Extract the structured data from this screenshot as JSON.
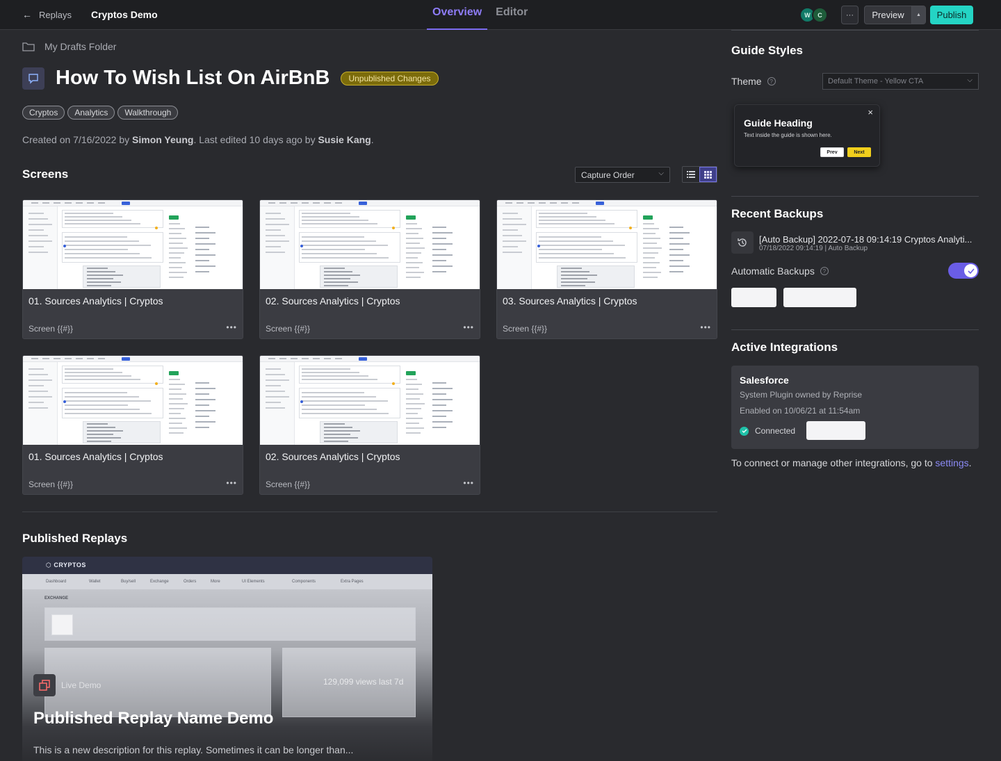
{
  "topbar": {
    "back_label": "Replays",
    "project_title": "Cryptos Demo",
    "tabs": [
      {
        "label": "Overview",
        "active": true
      },
      {
        "label": "Editor",
        "active": false
      }
    ],
    "avatars": [
      "W",
      "C"
    ],
    "more_label": "···",
    "preview_label": "Preview",
    "publish_label": "Publish"
  },
  "main": {
    "folder": "My Drafts Folder",
    "title": "How To Wish List On AirBnB",
    "status_badge": "Unpublished Changes",
    "tags": [
      "Cryptos",
      "Analytics",
      "Walkthrough"
    ],
    "created": {
      "prefix": "Created on 7/16/2022 by ",
      "creator": "Simon Yeung",
      "middle": ". Last edited 10 days ago by ",
      "editor": "Susie Kang",
      "suffix": "."
    },
    "screens_heading": "Screens",
    "sort": {
      "selected": "Capture Order"
    },
    "view_mode": "grid",
    "screens": [
      {
        "name": "01. Sources Analytics | Cryptos",
        "meta": "Screen {{#}}"
      },
      {
        "name": "02. Sources Analytics | Cryptos",
        "meta": "Screen {{#}}"
      },
      {
        "name": "03. Sources Analytics | Cryptos",
        "meta": "Screen {{#}}"
      },
      {
        "name": "01. Sources Analytics | Cryptos",
        "meta": "Screen {{#}}"
      },
      {
        "name": "02. Sources Analytics | Cryptos",
        "meta": "Screen {{#}}"
      }
    ],
    "card_more": "•••",
    "published_heading": "Published Replays",
    "replay": {
      "thumb_logo": "CRYPTOS",
      "thumb_nav": [
        "Dashboard",
        "Wallet",
        "Buy/sell",
        "Exchange",
        "Orders",
        "More",
        "UI Elements",
        "Components",
        "Extra Pages"
      ],
      "thumb_section": "EXCHANGE",
      "type_label": "Live Demo",
      "views": "129,099 views last 7d",
      "name": "Published Replay Name Demo",
      "description": "This is a new description for this replay. Sometimes it can be longer than..."
    }
  },
  "sidebar": {
    "guide_styles": {
      "heading": "Guide Styles",
      "theme_label": "Theme",
      "theme_value": "Default Theme - Yellow CTA",
      "preview": {
        "heading": "Guide Heading",
        "text": "Text inside the guide is shown here.",
        "prev": "Prev",
        "next": "Next",
        "close": "×"
      }
    },
    "recent_backups": {
      "heading": "Recent Backups",
      "items": [
        {
          "name": "[Auto Backup] 2022-07-18 09:14:19 Cryptos Analyti...",
          "meta": "07/18/2022 09:14:19 | Auto Backup"
        }
      ],
      "auto_label": "Automatic Backups",
      "auto_enabled": true
    },
    "integrations": {
      "heading": "Active Integrations",
      "items": [
        {
          "name": "Salesforce",
          "owner": "System Plugin owned by Reprise",
          "enabled": "Enabled on 10/06/21 at 11:54am",
          "status": "Connected"
        }
      ],
      "note_prefix": "To connect or manage other integrations, go to ",
      "note_link": "settings",
      "note_suffix": "."
    }
  },
  "colors": {
    "accent": "#7c6bf0",
    "publish": "#24d4c4",
    "badge": "#c8b12c",
    "connected": "#1fc1a8"
  }
}
